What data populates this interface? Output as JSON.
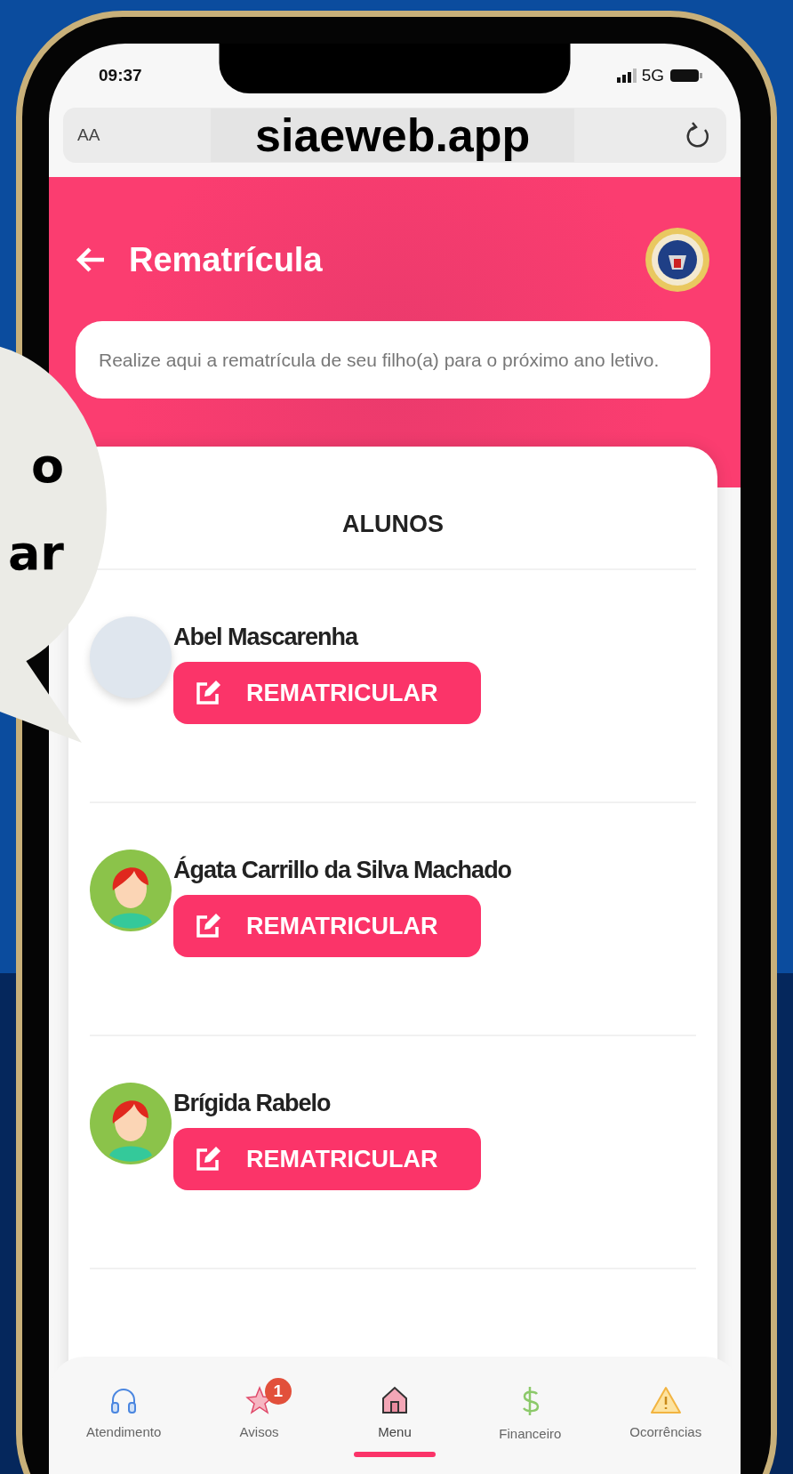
{
  "status_bar": {
    "time": "09:37",
    "network": "5G"
  },
  "browser": {
    "text_size_button": "AA",
    "url": "siaeweb.app"
  },
  "header": {
    "title": "Rematrícula"
  },
  "intro": "Realize aqui a rematrícula de seu filho(a) para o próximo ano letivo.",
  "students": {
    "title": "ALUNOS",
    "items": [
      {
        "name": "Abel Mascarenha",
        "kind": "photo",
        "action": "REMATRICULAR"
      },
      {
        "name": "Ágata Carrillo da Silva Machado",
        "kind": "avatar",
        "action": "REMATRICULAR"
      },
      {
        "name": "Brígida Rabelo",
        "kind": "avatar",
        "action": "REMATRICULAR"
      }
    ]
  },
  "bottom_nav": [
    {
      "label": "Atendimento",
      "kind": "support",
      "selected": false
    },
    {
      "label": "Avisos",
      "kind": "notices",
      "badge": "1",
      "selected": false
    },
    {
      "label": "Menu",
      "kind": "home",
      "selected": true
    },
    {
      "label": "Financeiro",
      "kind": "finance",
      "selected": false
    },
    {
      "label": "Ocorrências",
      "kind": "incidents",
      "selected": false
    }
  ],
  "callout": {
    "lines": [
      "o",
      "ar"
    ]
  }
}
